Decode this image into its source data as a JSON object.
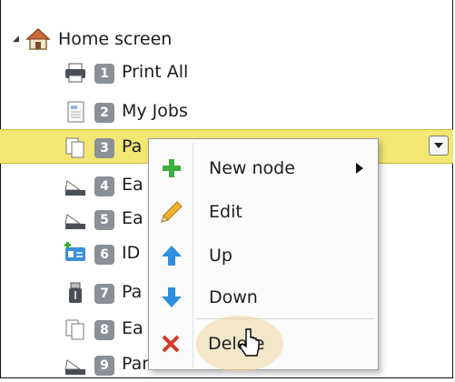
{
  "tree": {
    "root": {
      "label": "Home screen",
      "icon": "home-icon",
      "expanded": true
    },
    "items": [
      {
        "num": "1",
        "label": "Print All",
        "icon": "printer-icon"
      },
      {
        "num": "2",
        "label": "My Jobs",
        "icon": "document-icon"
      },
      {
        "num": "3",
        "label": "Pa",
        "icon": "copy-document-icon",
        "selected": true
      },
      {
        "num": "4",
        "label": "Ea",
        "icon": "scanner-icon"
      },
      {
        "num": "5",
        "label": "Ea",
        "icon": "scanner-icon"
      },
      {
        "num": "6",
        "label": "ID",
        "icon": "id-card-icon"
      },
      {
        "num": "7",
        "label": "Pa",
        "icon": "usb-icon"
      },
      {
        "num": "8",
        "label": "Ea",
        "icon": "copy-document-icon"
      },
      {
        "num": "9",
        "label": "Panel scan",
        "icon": "scanner-icon"
      }
    ]
  },
  "context_menu": {
    "items": [
      {
        "label": "New node",
        "icon": "plus-icon",
        "has_submenu": true
      },
      {
        "label": "Edit",
        "icon": "pencil-icon"
      },
      {
        "label": "Up",
        "icon": "arrow-up-icon"
      },
      {
        "label": "Down",
        "icon": "arrow-down-icon"
      },
      {
        "label": "Delete",
        "icon": "delete-x-icon",
        "hovered": true
      }
    ]
  },
  "colors": {
    "selection": "#f3e773",
    "badge": "#8a9096",
    "plus": "#3cae3c",
    "arrow": "#2f8fe0",
    "delete": "#d43a2a"
  }
}
